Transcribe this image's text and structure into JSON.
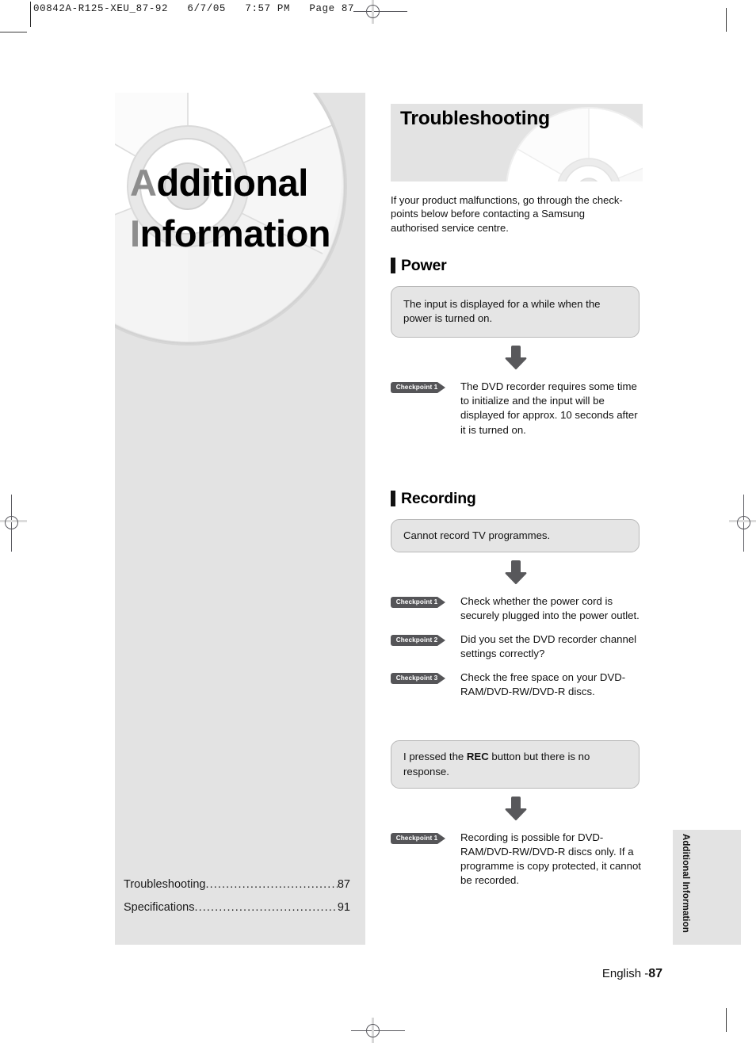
{
  "print_slug": {
    "text": "00842A-R125-XEU_87-92   6/7/05   7:57 PM   Page 87"
  },
  "chapter": {
    "title_line1_cap": "A",
    "title_line1_rest": "dditional",
    "title_line2_cap": "I",
    "title_line2_rest": "nformation",
    "toc": [
      {
        "label": "Troubleshooting",
        "page": "87"
      },
      {
        "label": "Specifications",
        "page": "91"
      }
    ],
    "dot_leader": "................................................................"
  },
  "banner": {
    "title": "Troubleshooting"
  },
  "intro": {
    "text": "If your product malfunctions, go through the check-points below before contacting a Samsung authorised service centre."
  },
  "sections": [
    {
      "heading": "Power",
      "blocks": [
        {
          "question": "The input is displayed for a while when the power is turned on.",
          "checkpoints": [
            {
              "badge": "Checkpoint 1",
              "text": "The DVD recorder requires some time to initialize and the input will be displayed for approx. 10 seconds after it is turned on."
            }
          ]
        }
      ]
    },
    {
      "heading": "Recording",
      "blocks": [
        {
          "question": "Cannot record TV programmes.",
          "checkpoints": [
            {
              "badge": "Checkpoint 1",
              "text": "Check whether the power cord is securely plugged into the power outlet."
            },
            {
              "badge": "Checkpoint 2",
              "text": "Did you set the DVD recorder channel settings correctly?"
            },
            {
              "badge": "Checkpoint 3",
              "text": "Check the free space on your DVD-RAM/DVD-RW/DVD-R discs."
            }
          ]
        },
        {
          "question_pre": "I pressed the ",
          "question_bold": "REC",
          "question_post": " button but there is no response.",
          "checkpoints": [
            {
              "badge": "Checkpoint 1",
              "text": "Recording is possible for DVD-RAM/DVD-RW/DVD-R discs only. If a programme is copy protected, it cannot be recorded."
            }
          ]
        }
      ]
    }
  ],
  "side_tab": {
    "label": "Additional Information"
  },
  "footer": {
    "language": "English -",
    "page": "87"
  },
  "colors": {
    "panel_gray": "#e3e3e3",
    "bubble_gray": "#e5e5e5",
    "badge_gray": "#555558",
    "arrow_gray": "#58585b",
    "title_cap_gray": "#8d8d8d"
  }
}
